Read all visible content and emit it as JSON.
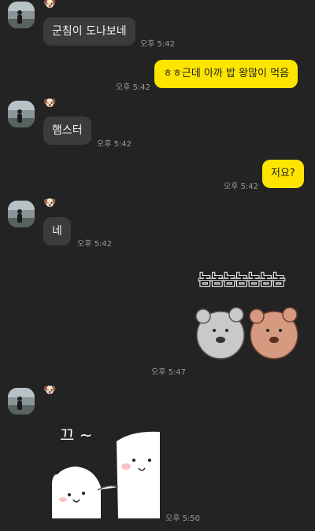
{
  "chat": {
    "sender_name": "🐶",
    "messages": [
      {
        "side": "in",
        "text": "군침이 도나보네",
        "time": "오후 5:42"
      },
      {
        "side": "out",
        "text": "ㅎㅎ근데 아까 밥 왕많이 먹음",
        "time": "오후 5:42"
      },
      {
        "side": "in",
        "text": "햄스터",
        "time": "오후 5:42"
      },
      {
        "side": "out",
        "text": "저요?",
        "time": "오후 5:42"
      },
      {
        "side": "in",
        "text": "네",
        "time": "오후 5:42"
      },
      {
        "side": "out",
        "sticker": "bears-eating",
        "sticker_text": "놈놈놈놈놈놈놈",
        "time": "오후 5:47"
      },
      {
        "side": "in",
        "sticker": "ghosts-hug",
        "sticker_text": "끄 ~",
        "time": "오후 5:50"
      }
    ]
  },
  "colors": {
    "background": "#232323",
    "incoming_bubble": "#3b3b3b",
    "outgoing_bubble": "#fee500"
  }
}
